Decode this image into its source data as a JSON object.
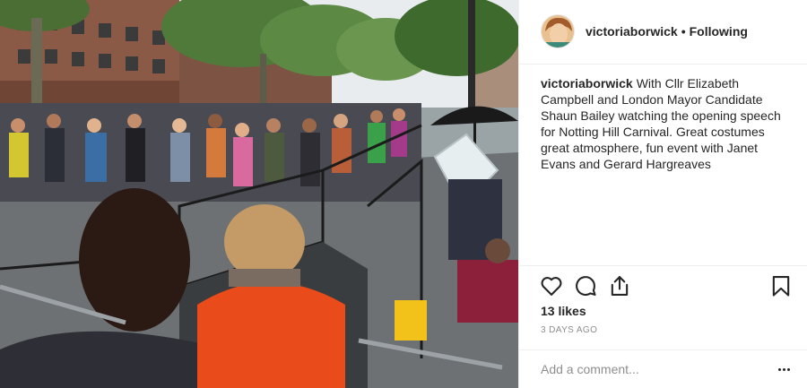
{
  "post": {
    "photo_icon": "street-carnival-photo",
    "author": {
      "username": "victoriaborwick",
      "separator": "•",
      "follow_status": "Following",
      "avatar_icon": "profile-avatar"
    },
    "caption": {
      "username": "victoriaborwick",
      "text": "With Cllr Elizabeth Campbell and London Mayor Candidate Shaun Bailey watching the opening speech for Notting Hill Carnival. Great costumes great atmosphere, fun event with Janet Evans and Gerard Hargreaves"
    },
    "actions": {
      "like_icon": "heart-icon",
      "comment_icon": "comment-icon",
      "share_icon": "share-icon",
      "save_icon": "bookmark-icon"
    },
    "likes": "13 likes",
    "time_ago": "3 DAYS AGO",
    "comment": {
      "placeholder": "Add a comment...",
      "more_icon": "more-options-icon"
    }
  }
}
